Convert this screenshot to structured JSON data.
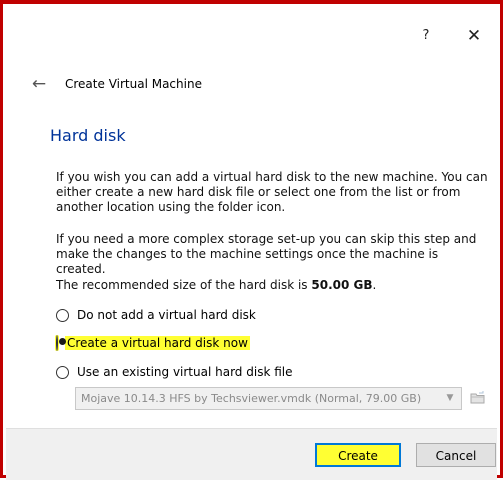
{
  "window": {
    "help_label": "?",
    "close_label": "✕"
  },
  "wizard": {
    "back_icon": "←",
    "title": "Create Virtual Machine",
    "section_title": "Hard disk"
  },
  "body_text": {
    "paragraph1": "If you wish you can add a virtual hard disk to the new machine. You can either create a new hard disk file or select one from the list or from another location using the folder icon.",
    "paragraph2": "If you need a more complex storage set-up you can skip this step and make the changes to the machine settings once the machine is created.",
    "size_prefix": "The recommended size of the hard disk is ",
    "size_value": "50.00 GB",
    "size_suffix": "."
  },
  "options": [
    {
      "label": "Do not add a virtual hard disk",
      "checked": false
    },
    {
      "label": "Create a virtual hard disk now",
      "checked": true,
      "highlighted": true
    },
    {
      "label": "Use an existing virtual hard disk file",
      "checked": false
    }
  ],
  "existing_disk": {
    "selected": "Mojave 10.14.3 HFS by Techsviewer.vmdk (Normal, 79.00 GB)",
    "enabled": false
  },
  "buttons": {
    "create": "Create",
    "cancel": "Cancel"
  },
  "colors": {
    "border": "#c00000",
    "section_title": "#003399",
    "highlight": "#ffff33",
    "focus": "#0078d7"
  },
  "icons": {
    "help": "help-icon",
    "close": "close-icon",
    "back": "back-arrow-icon",
    "folder": "folder-icon",
    "dropdown": "chevron-down-icon"
  }
}
